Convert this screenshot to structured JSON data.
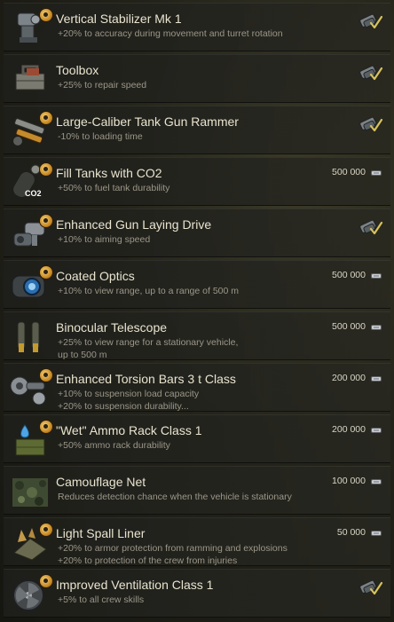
{
  "currency_icon": "silver-coin-icon",
  "owned_icon": "in-depot-check-icon",
  "items": [
    {
      "title": "Vertical Stabilizer Mk 1",
      "desc": [
        "+20% to accuracy during movement and turret rotation"
      ],
      "price": "",
      "owned": true,
      "icon": "stabilizer-icon",
      "badge": true
    },
    {
      "title": "Toolbox",
      "desc": [
        "+25% to repair speed"
      ],
      "price": "",
      "owned": true,
      "icon": "toolbox-icon",
      "badge": false
    },
    {
      "title": "Large-Caliber Tank Gun Rammer",
      "desc": [
        "-10% to loading time"
      ],
      "price": "",
      "owned": true,
      "icon": "gun-rammer-icon",
      "badge": true
    },
    {
      "title": "Fill Tanks with CO2",
      "desc": [
        "+50% to fuel tank durability"
      ],
      "price": "500 000",
      "owned": false,
      "icon": "co2-extinguisher-icon",
      "badge": true,
      "icon_text": "CO2"
    },
    {
      "title": "Enhanced Gun Laying Drive",
      "desc": [
        "+10% to aiming speed"
      ],
      "price": "",
      "owned": true,
      "icon": "gun-laying-drive-icon",
      "badge": true
    },
    {
      "title": "Coated Optics",
      "desc": [
        "+10% to view range, up to a range of 500 m"
      ],
      "price": "500 000",
      "owned": false,
      "icon": "coated-optics-icon",
      "badge": true
    },
    {
      "title": "Binocular Telescope",
      "desc": [
        "+25% to view range for a stationary vehicle,",
        "up to 500 m"
      ],
      "price": "500 000",
      "owned": false,
      "icon": "binocular-telescope-icon",
      "badge": false
    },
    {
      "title": "Enhanced Torsion Bars 3 t Class",
      "desc": [
        "+10% to suspension load capacity",
        "+20% to suspension durability..."
      ],
      "price": "200 000",
      "owned": false,
      "icon": "torsion-bars-icon",
      "badge": true
    },
    {
      "title": "\"Wet\" Ammo Rack Class 1",
      "desc": [
        "+50% ammo rack durability"
      ],
      "price": "200 000",
      "owned": false,
      "icon": "wet-ammo-rack-icon",
      "badge": true
    },
    {
      "title": "Camouflage Net",
      "desc": [
        "Reduces detection chance when the vehicle is stationary"
      ],
      "price": "100 000",
      "owned": false,
      "icon": "camouflage-net-icon",
      "badge": false
    },
    {
      "title": "Light Spall Liner",
      "desc": [
        "+20% to armor protection from ramming and explosions",
        "+20% to protection of the crew from injuries"
      ],
      "price": "50 000",
      "owned": false,
      "icon": "spall-liner-icon",
      "badge": true
    },
    {
      "title": "Improved Ventilation Class 1",
      "desc": [
        "+5% to all crew skills"
      ],
      "price": "",
      "owned": true,
      "icon": "ventilation-icon",
      "badge": true
    }
  ]
}
